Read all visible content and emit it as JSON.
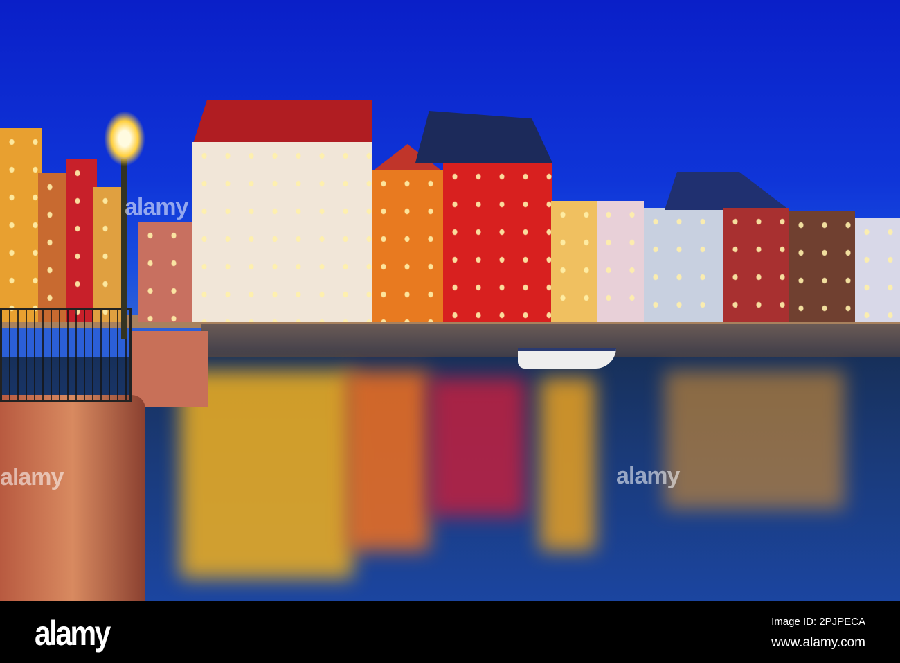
{
  "photo": {
    "subject": "Nyhavn canal, Copenhagen at night"
  },
  "watermark": "alamy",
  "footer": {
    "logo": "alamy",
    "image_id": "Image ID: 2PJPECA",
    "website": "www.alamy.com"
  },
  "colors": {
    "sky": "#0f35d8",
    "water": "#1a3a78",
    "lamp": "#ffd040"
  }
}
